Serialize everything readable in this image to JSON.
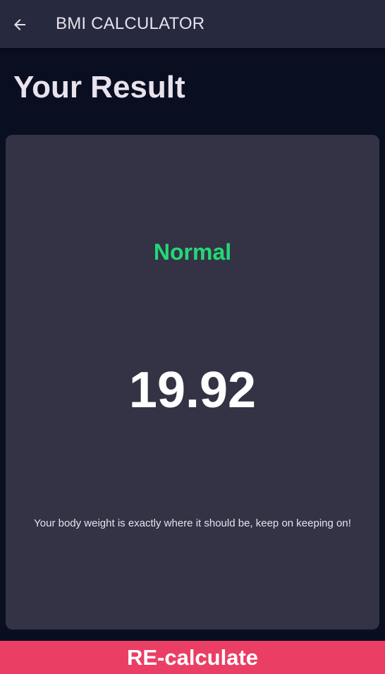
{
  "appbar": {
    "back_icon": "arrow-left-icon",
    "title": "BMI CALCULATOR"
  },
  "page": {
    "title": "Your Result"
  },
  "result": {
    "status": "Normal",
    "bmi": "19.92",
    "advice": "Your body weight is exactly where it should be, keep on keeping on!"
  },
  "action": {
    "recalculate_label": "RE-calculate"
  },
  "colors": {
    "background": "#0a0e21",
    "appbar": "#272a3e",
    "card": "#343345",
    "status_green": "#24d876",
    "accent_pink": "#eb3e65"
  }
}
